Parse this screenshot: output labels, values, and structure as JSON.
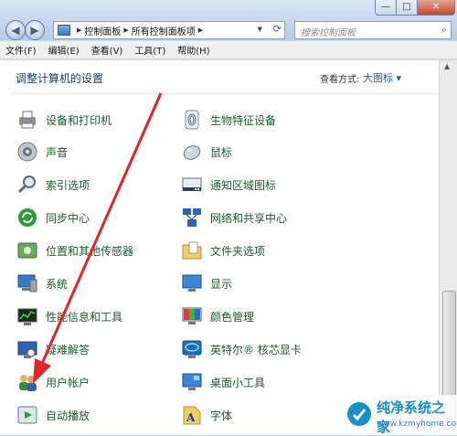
{
  "window": {
    "min_label": "—",
    "max_label": "□",
    "close_label": "✕"
  },
  "address": {
    "crumbs": [
      "控制面板",
      "所有控制面板项"
    ]
  },
  "search": {
    "placeholder": "搜索控制面板"
  },
  "menubar": [
    "文件(F)",
    "编辑(E)",
    "查看(V)",
    "工具(T)",
    "帮助(H)"
  ],
  "content": {
    "title": "调整计算机的设置",
    "view_by_label": "查看方式:",
    "view_by_value": "大图标 ▾"
  },
  "items_left": [
    {
      "label": "设备和打印机",
      "icon": "printer-icon"
    },
    {
      "label": "声音",
      "icon": "speaker-icon"
    },
    {
      "label": "索引选项",
      "icon": "index-icon"
    },
    {
      "label": "同步中心",
      "icon": "sync-icon"
    },
    {
      "label": "位置和其他传感器",
      "icon": "sensor-icon"
    },
    {
      "label": "系统",
      "icon": "system-icon"
    },
    {
      "label": "性能信息和工具",
      "icon": "performance-icon"
    },
    {
      "label": "疑难解答",
      "icon": "troubleshoot-icon"
    },
    {
      "label": "用户帐户",
      "icon": "users-icon"
    },
    {
      "label": "自动播放",
      "icon": "autoplay-icon"
    }
  ],
  "items_right": [
    {
      "label": "生物特征设备",
      "icon": "fingerprint-icon"
    },
    {
      "label": "鼠标",
      "icon": "mouse-icon"
    },
    {
      "label": "通知区域图标",
      "icon": "notification-icon"
    },
    {
      "label": "网络和共享中心",
      "icon": "network-icon"
    },
    {
      "label": "文件夹选项",
      "icon": "folder-icon"
    },
    {
      "label": "显示",
      "icon": "display-icon"
    },
    {
      "label": "颜色管理",
      "icon": "color-icon"
    },
    {
      "label": "英特尔® 核芯显卡",
      "icon": "intel-graphics-icon"
    },
    {
      "label": "桌面小工具",
      "icon": "gadgets-icon"
    },
    {
      "label": "字体",
      "icon": "font-icon"
    }
  ],
  "watermark": {
    "text": "纯净系统之家",
    "url": "www.kzmyhome.com"
  },
  "colors": {
    "link_green": "#1c5c2e",
    "title_blue": "#1e395b",
    "arrow_red": "#e0262a"
  }
}
